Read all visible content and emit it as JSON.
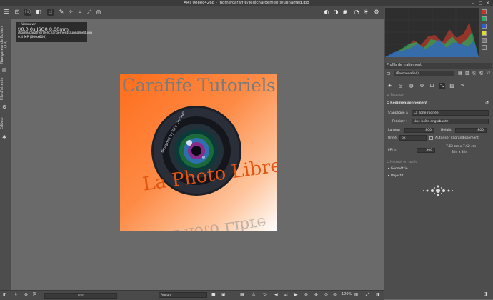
{
  "window": {
    "title": "ART 0eeec4268 - /home/carafife/Téléchargements/unnamed.jpg"
  },
  "side_tabs": {
    "file_browser": "Navigateur de fichiers",
    "file_browser_count": "(19)",
    "queue": "File d'attente",
    "editor": "Éditeur"
  },
  "image_info": {
    "name": "+ Unknown",
    "exposure": "f/0.0  0s  ISO0  0.00mm",
    "path": "/home/carafife/Téléchargements/unnamed.jpg",
    "size": "0.4 MP (600x600)"
  },
  "photo": {
    "title": "Carafife Tutoriels",
    "subtitle": "La Photo Libre",
    "reflection": "La Photo Libre",
    "lens_text": "Designed by Eli's Chicago"
  },
  "bottom_bar": {
    "preview_label": "Prêt",
    "profile_select": "Aucun",
    "zoom": "100%"
  },
  "right_panel": {
    "profiles_header": "Profils de traitement",
    "profile_value": "(Personnalisé)",
    "presets_label": "Réglage",
    "resize_header": "Redimensionnement",
    "applies_to_label": "S'applique à :",
    "applies_to_value": "La zone rognée",
    "specify_label": "Préciser :",
    "specify_value": "Une boîte englobante",
    "width_label": "Largeur",
    "width_value": "800",
    "height_label": "Height:",
    "height_value": "800",
    "unit_label": "Unité",
    "unit_value": "px",
    "allow_upscale_label": "Autoriser l'agrandissement",
    "ppi_label": "PPI =",
    "ppi_value": "300",
    "print_size": "7.62 cm x 7.62 cm",
    "print_size_in": "3 in x 3 in",
    "output_sharpening": "Netteté en sortie",
    "geometry": "Géométrie",
    "lens": "Objectif"
  },
  "colors": {
    "photo_gradient_start": "#ff6e1c",
    "subtitle_orange": "#e4530f",
    "title_gray": "#7b7b7b"
  }
}
